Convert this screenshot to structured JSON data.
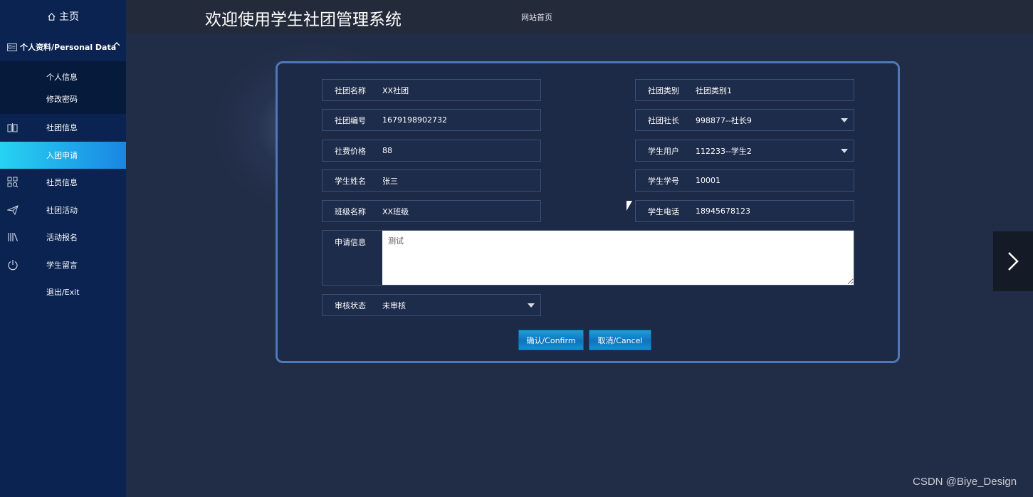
{
  "sidebar": {
    "home": "主页",
    "section": "个人资料/Personal Data",
    "sub_items": [
      "个人信息",
      "修改密码"
    ],
    "items": [
      {
        "label": "社团信息",
        "icon": "book-icon"
      },
      {
        "label": "入团申请",
        "icon": "none",
        "active": true
      },
      {
        "label": "社员信息",
        "icon": "grid-search-icon"
      },
      {
        "label": "社团活动",
        "icon": "paper-plane-icon"
      },
      {
        "label": "活动报名",
        "icon": "library-icon"
      },
      {
        "label": "学生留言",
        "icon": "power-icon"
      },
      {
        "label": "退出/Exit",
        "icon": "none"
      }
    ]
  },
  "header": {
    "title": "欢迎使用学生社团管理系统",
    "nav": "网站首页"
  },
  "form": {
    "club_name": {
      "label": "社团名称",
      "value": "XX社团"
    },
    "club_type": {
      "label": "社团类别",
      "value": "社团类别1"
    },
    "club_no": {
      "label": "社团编号",
      "value": "1679198902732"
    },
    "club_leader": {
      "label": "社团社长",
      "value": "998877--社长9"
    },
    "fee": {
      "label": "社费价格",
      "value": "88"
    },
    "student_user": {
      "label": "学生用户",
      "value": "112233--学生2"
    },
    "student_name": {
      "label": "学生姓名",
      "value": "张三"
    },
    "student_no": {
      "label": "学生学号",
      "value": "10001"
    },
    "class_name": {
      "label": "班级名称",
      "value": "XX班级"
    },
    "student_phone": {
      "label": "学生电话",
      "value": "18945678123"
    },
    "apply_info": {
      "label": "申请信息",
      "value": "测试"
    },
    "review_status": {
      "label": "审核状态",
      "value": "未审核"
    },
    "confirm": "确认/Confirm",
    "cancel": "取消/Cancel"
  },
  "watermark": "CSDN @Biye_Design",
  "colors": {
    "sidebar_bg": "#0b2350",
    "active_item": "#1a86e3",
    "page_bg": "#212c46",
    "panel_border": "#4f78b7"
  }
}
